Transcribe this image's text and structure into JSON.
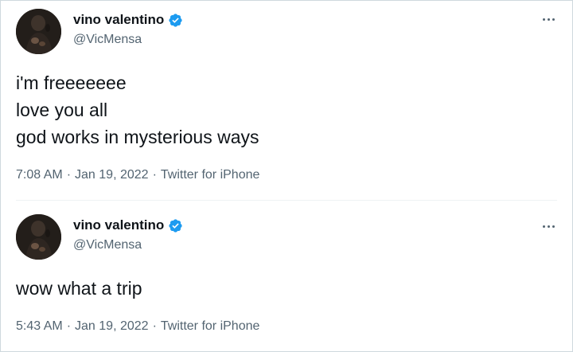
{
  "tweets": [
    {
      "display_name": "vino valentino",
      "handle": "@VicMensa",
      "verified": true,
      "text": "i'm freeeeeee\nlove you all\ngod works in mysterious ways",
      "time": "7:08 AM",
      "date": "Jan 19, 2022",
      "source": "Twitter for iPhone",
      "separator": "·"
    },
    {
      "display_name": "vino valentino",
      "handle": "@VicMensa",
      "verified": true,
      "text": "wow what a trip",
      "time": "5:43 AM",
      "date": "Jan 19, 2022",
      "source": "Twitter for iPhone",
      "separator": "·"
    }
  ],
  "colors": {
    "verified_badge": "#1d9bf0",
    "secondary_text": "#536471",
    "primary_text": "#0f1419",
    "border": "#cfd9de"
  },
  "icons": {
    "avatar": "avatar-photo",
    "verified": "verified-badge-icon",
    "more": "more-options-icon"
  }
}
